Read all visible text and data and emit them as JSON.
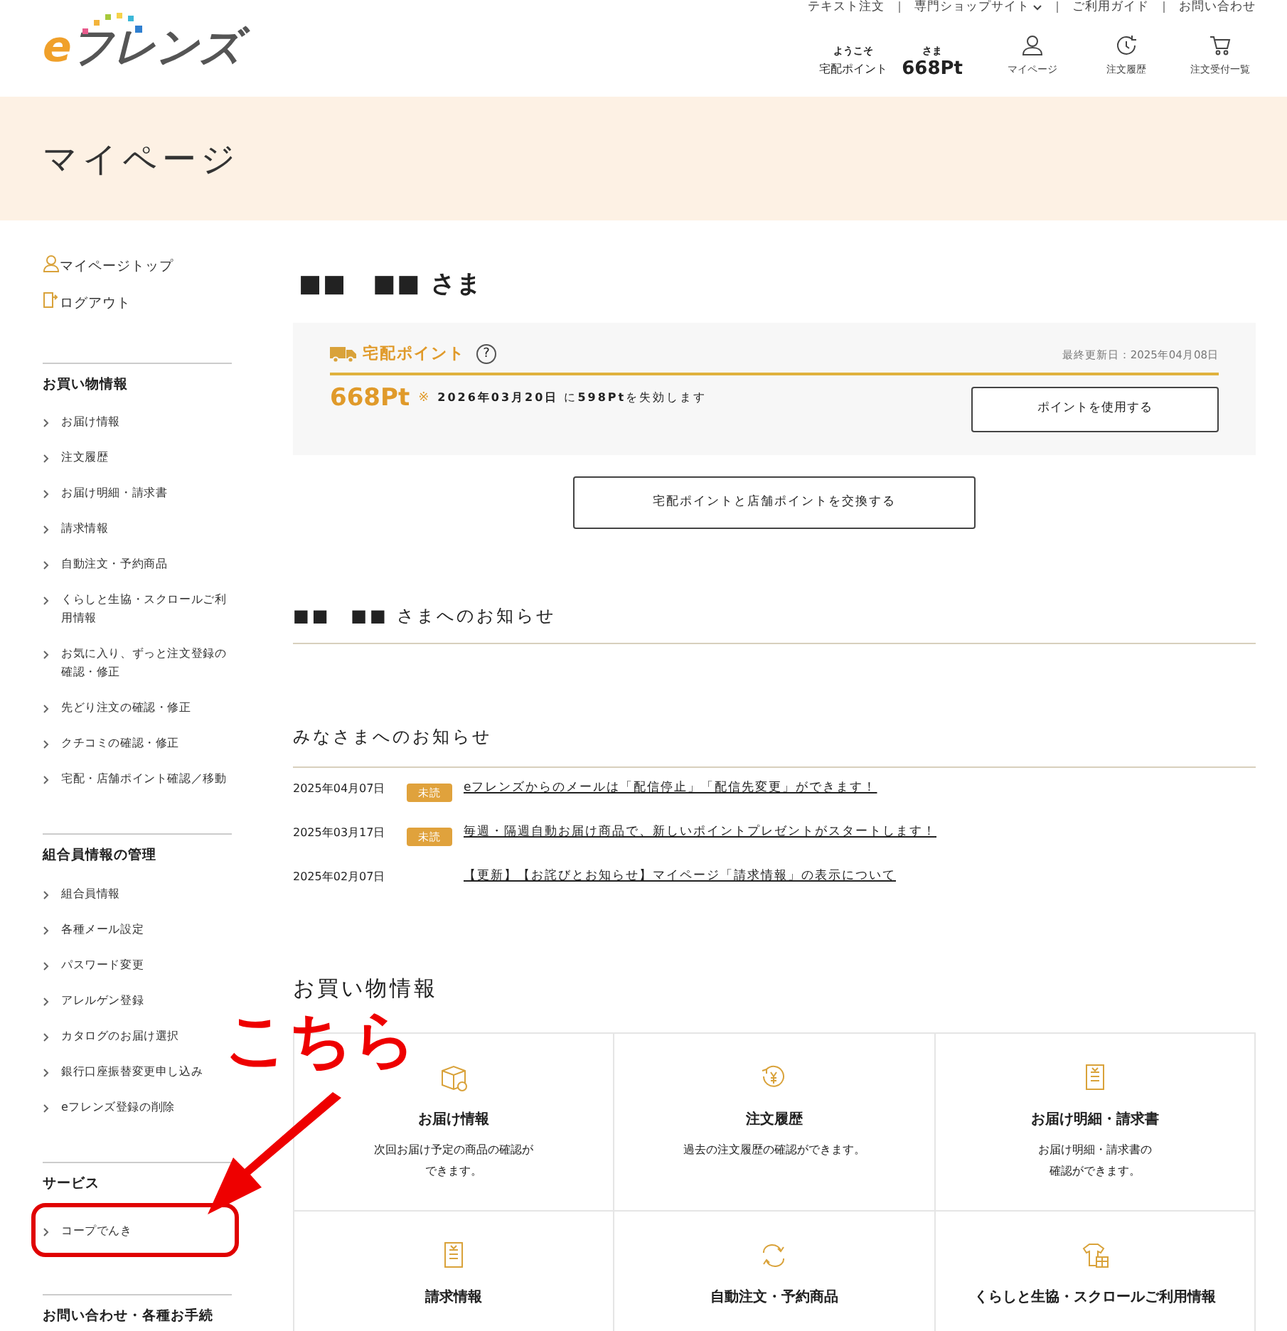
{
  "header": {
    "logo": "eフレンズ",
    "top_links": [
      {
        "label": "テキスト注文"
      },
      {
        "label": "専門ショップサイト",
        "caret": true
      },
      {
        "label": "ご利用ガイド"
      },
      {
        "label": "お問い合わせ"
      }
    ],
    "welcome": {
      "greeting": "ようこそ",
      "honorific": "さま",
      "label": "宅配ポイント",
      "points": "668Pt"
    },
    "nav": [
      {
        "label": "マイページ"
      },
      {
        "label": "注文履歴"
      },
      {
        "label": "注文受付一覧"
      }
    ]
  },
  "page_title": "マイページ",
  "sidebar": {
    "account_links": [
      {
        "label": "マイページトップ"
      },
      {
        "label": "ログアウト"
      }
    ],
    "sections": [
      {
        "heading": "お買い物情報",
        "items": [
          {
            "label": "お届け情報"
          },
          {
            "label": "注文履歴"
          },
          {
            "label": "お届け明細・請求書"
          },
          {
            "label": "請求情報"
          },
          {
            "label": "自動注文・予約商品"
          },
          {
            "label": "くらしと生協・スクロールご利用情報"
          },
          {
            "label": "お気に入り、ずっと注文登録の確認・修正"
          },
          {
            "label": "先どり注文の確認・修正"
          },
          {
            "label": "クチコミの確認・修正"
          },
          {
            "label": "宅配・店舗ポイント確認／移動"
          }
        ]
      },
      {
        "heading": "組合員情報の管理",
        "items": [
          {
            "label": "組合員情報"
          },
          {
            "label": "各種メール設定"
          },
          {
            "label": "パスワード変更"
          },
          {
            "label": "アレルゲン登録"
          },
          {
            "label": "カタログのお届け選択"
          },
          {
            "label": "銀行口座振替変更申し込み"
          },
          {
            "label": "eフレンズ登録の削除"
          }
        ]
      },
      {
        "heading": "サービス",
        "items": [
          {
            "label": "コープでんき",
            "highlighted": true
          }
        ]
      },
      {
        "heading": "お問い合わせ・各種お手続"
      }
    ]
  },
  "main": {
    "user_name": "■■　■■ さま",
    "points_panel": {
      "title": "宅配ポイント",
      "help": "?",
      "updated": "最終更新日：2025年04月08日",
      "amount": "668Pt",
      "expiry_mark": "※",
      "expiry_text": "**2026年03月20日** に**598Pt**を失効します",
      "use_button": "ポイントを使用する"
    },
    "exchange_button": "宅配ポイントと店舗ポイントを交換する",
    "personal_notices_heading": "■■　■■ さまへのお知らせ",
    "public_notices_heading": "みなさまへのお知らせ",
    "notices": [
      {
        "date": "2025年04月07日",
        "unread": true,
        "badge": "未読",
        "title": "eフレンズからのメールは「配信停止」「配信先変更」ができます！"
      },
      {
        "date": "2025年03月17日",
        "unread": true,
        "badge": "未読",
        "title": "毎週・隔週自動お届け商品で、新しいポイントプレゼントがスタートします！"
      },
      {
        "date": "2025年02月07日",
        "unread": false,
        "title": "【更新】【お詫びとお知らせ】マイページ「請求情報」の表示について"
      }
    ],
    "shopping_heading": "お買い物情報",
    "cards": [
      {
        "title": "お届け情報",
        "description_lines": [
          "次回お届け予定の商品の確認が",
          "できます。"
        ]
      },
      {
        "title": "注文履歴",
        "description_lines": [
          "過去の注文履歴の確認ができます。"
        ]
      },
      {
        "title": "お届け明細・請求書",
        "description_lines": [
          "お届け明細・請求書の",
          "確認ができます。"
        ]
      },
      {
        "title": "請求情報"
      },
      {
        "title": "自動注文・予約商品"
      },
      {
        "title": "くらしと生協・スクロールご利用情報"
      }
    ]
  },
  "annotation": {
    "text": "こちら"
  }
}
